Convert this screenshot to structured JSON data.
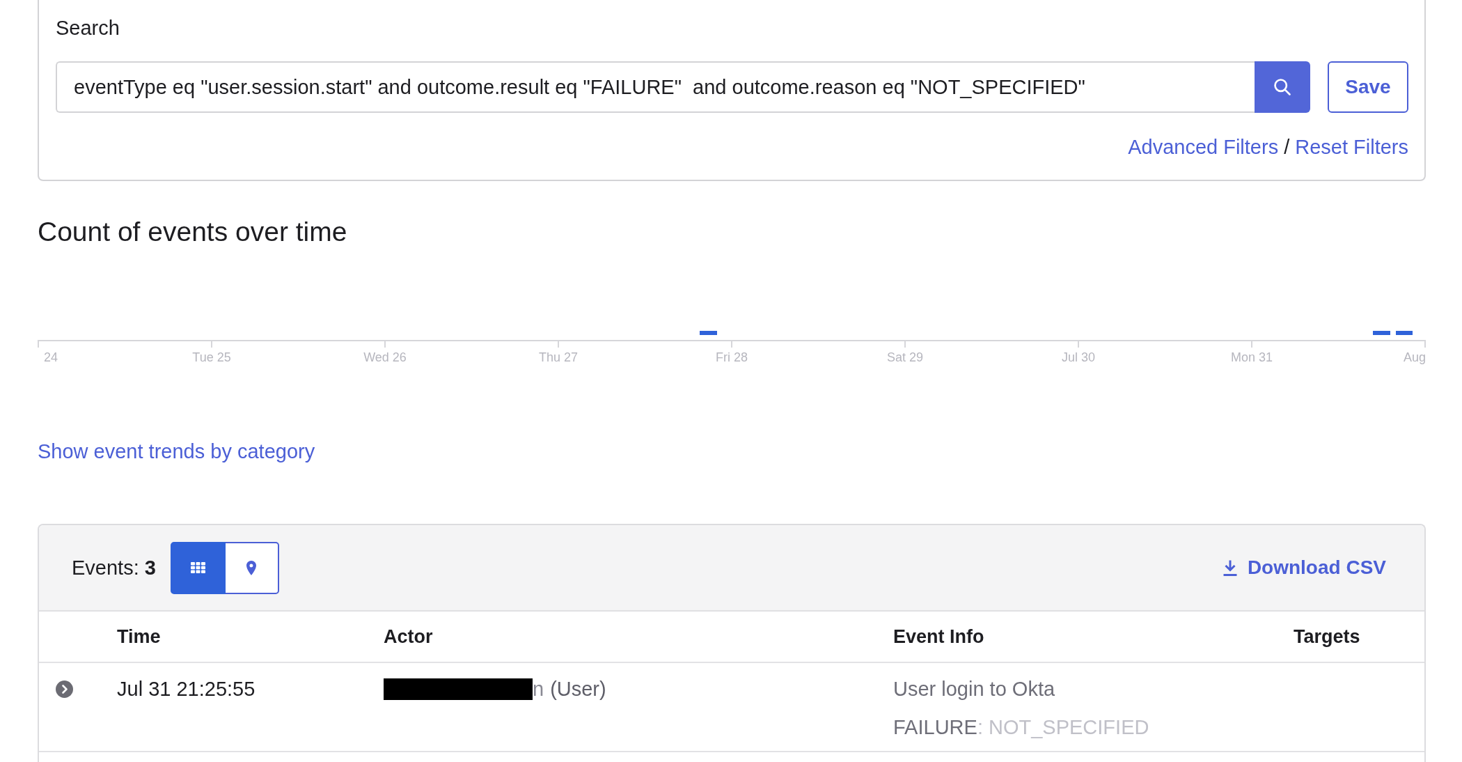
{
  "search": {
    "label": "Search",
    "query": {
      "value": "eventType eq \"user.session.start\" and outcome.result eq \"FAILURE\"  and outcome.reason eq \"NOT_SPECIFIED\""
    },
    "save_button": {
      "label": "Save"
    },
    "links": [
      {
        "label": "Advanced Filters"
      },
      {
        "label": "Reset Filters"
      }
    ],
    "link_separator": "/"
  },
  "chart": {
    "title": "Count of events over time",
    "axis_labels": [
      "24",
      "Tue 25",
      "Wed 26",
      "Thu 27",
      "Fri 28",
      "Sat 29",
      "Jul 30",
      "Mon 31",
      "Aug"
    ]
  },
  "trends_link": {
    "label": "Show event trends by category"
  },
  "events": {
    "count_text": "Events: **3**",
    "view_toggle": [
      {
        "kind": "grid",
        "selected": true
      },
      {
        "kind": "map",
        "selected": false
      }
    ],
    "download_button": {
      "label": "Download CSV"
    },
    "table": {
      "columns": [
        "Time",
        "Actor",
        "Event Info",
        "Targets"
      ],
      "rows": [
        {
          "expanded": false,
          "time": "Jul 31 21:25:55",
          "actor": {
            "redacted": true,
            "name": "n",
            "type": "(User)"
          },
          "event_info": {
            "title": "User login to Okta",
            "result": "FAILURE",
            "reason": ": NOT_SPECIFIED"
          }
        }
      ]
    }
  }
}
